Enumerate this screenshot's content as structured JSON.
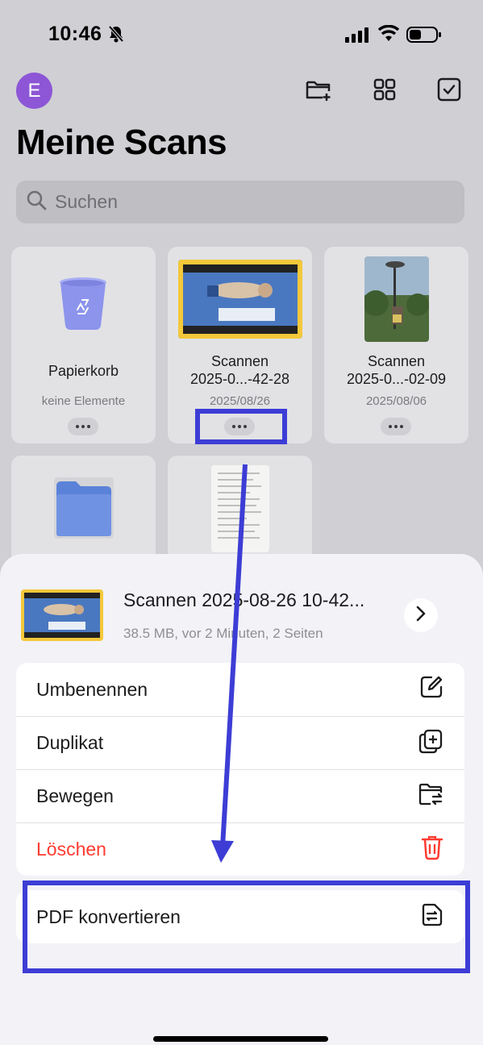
{
  "status_bar": {
    "time": "10:46"
  },
  "header": {
    "avatar_letter": "E",
    "title": "Meine Scans",
    "icons": [
      "new-folder-icon",
      "grid-view-icon",
      "select-checkbox-icon"
    ]
  },
  "search": {
    "placeholder": "Suchen"
  },
  "grid": {
    "items": [
      {
        "name": "Papierkorb",
        "meta": "keine Elemente",
        "icon": "trash-bin-icon"
      },
      {
        "name_line1": "Scannen",
        "name_line2": "2025-0...-42-28",
        "date": "2025/08/26"
      },
      {
        "name_line1": "Scannen",
        "name_line2": "2025-0...-02-09",
        "date": "2025/08/06"
      }
    ]
  },
  "sheet": {
    "title": "Scannen 2025-08-26 10-42...",
    "meta": "38.5 MB, vor 2 Minuten, 2 Seiten",
    "actions": [
      {
        "label": "Umbenennen",
        "icon": "rename-icon"
      },
      {
        "label": "Duplikat",
        "icon": "duplicate-icon"
      },
      {
        "label": "Bewegen",
        "icon": "move-folder-icon"
      },
      {
        "label": "Löschen",
        "icon": "trash-icon"
      }
    ],
    "convert_label": "PDF konvertieren"
  },
  "colors": {
    "accent": "#8d56d6",
    "danger": "#ff3b30",
    "annotation": "#3d3dd6"
  }
}
